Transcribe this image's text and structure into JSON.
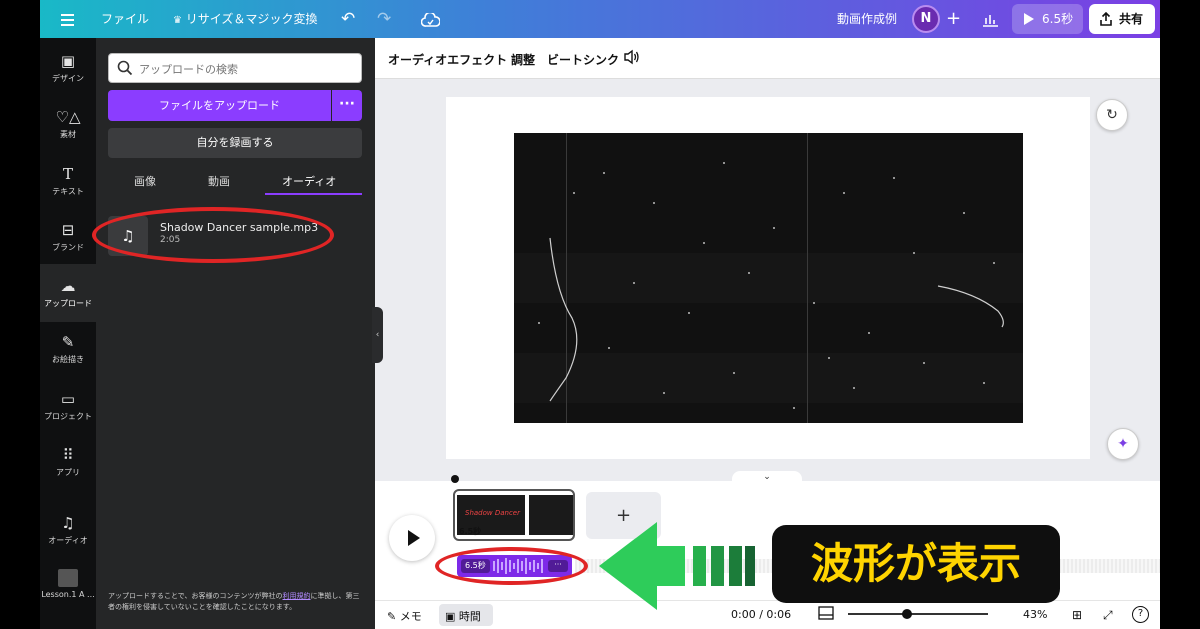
{
  "topbar": {
    "file_menu": "ファイル",
    "resize_label": "リサイズ＆マジック変換",
    "doc_title": "動画作成例",
    "avatar_initial": "N",
    "play_label": "6.5秒",
    "share_label": "共有"
  },
  "rail": {
    "items": [
      {
        "label": "デザイン",
        "icon": "design-icon"
      },
      {
        "label": "素材",
        "icon": "elements-icon"
      },
      {
        "label": "テキスト",
        "icon": "text-icon"
      },
      {
        "label": "ブランド",
        "icon": "brand-icon"
      },
      {
        "label": "アップロード",
        "icon": "upload-icon"
      },
      {
        "label": "お絵描き",
        "icon": "draw-icon"
      },
      {
        "label": "プロジェクト",
        "icon": "folder-icon"
      },
      {
        "label": "アプリ",
        "icon": "apps-icon"
      },
      {
        "label": "オーディオ",
        "icon": "music-icon"
      },
      {
        "label": "Lesson.1 A ...",
        "icon": "thumbnail"
      }
    ]
  },
  "panel": {
    "search_placeholder": "アップロードの検索",
    "upload_button": "ファイルをアップロード",
    "more_label": "···",
    "record_button": "自分を録画する",
    "tabs": [
      "画像",
      "動画",
      "オーディオ"
    ],
    "audio_file": {
      "name": "Shadow Dancer sample.mp3",
      "duration": "2:05"
    },
    "footer_pre": "アップロードすることで、お客様のコンテンツが弊社の",
    "footer_link": "利用規約",
    "footer_post": "に準拠し、第三者の権利を侵害していないことを確認したことになります。"
  },
  "toolbar": {
    "audio_effects": "オーディオエフェクト",
    "adjust": "調整",
    "beat_sync": "ビートシンク"
  },
  "timeline": {
    "clip_duration": "6.5秒",
    "clip_title": "Shadow Dancer",
    "audio_duration": "6.5秒",
    "audio_more": "···",
    "add_label": "+"
  },
  "bottom": {
    "memo": "メモ",
    "time": "時間",
    "timecode": "0:00 / 0:06",
    "zoom": "43%",
    "help": "?"
  },
  "callout": {
    "text": "波形が表示"
  },
  "colors": {
    "accent": "#8b3dff",
    "highlight_circle": "#e02525",
    "arrow_green": "#2ecc5a",
    "callout_text": "#ffd400"
  }
}
